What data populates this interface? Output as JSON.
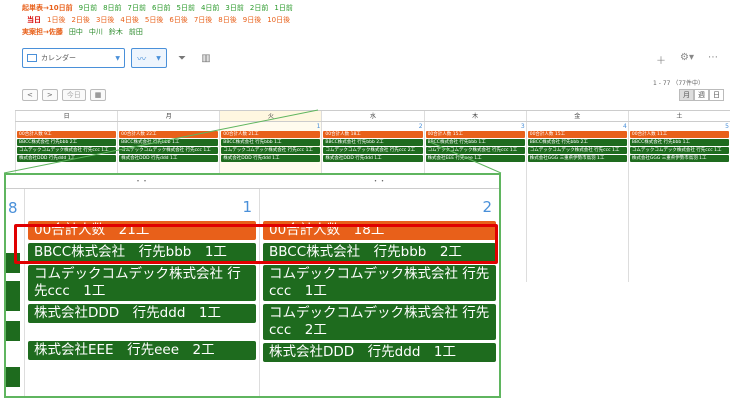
{
  "filters": {
    "row1": {
      "label": "起単表→10日前",
      "links": [
        "9日前",
        "8日前",
        "7日前",
        "6日前",
        "5日前",
        "4日前",
        "3日前",
        "2日前",
        "1日前"
      ]
    },
    "row2": {
      "links": [
        "当日",
        "1日後",
        "2日後",
        "3日後",
        "4日後",
        "5日後",
        "6日後",
        "7日後",
        "8日後",
        "9日後",
        "10日後"
      ]
    },
    "row3": {
      "label": "実案担→佐藤",
      "links": [
        "田中",
        "中川",
        "鈴木",
        "前田"
      ]
    }
  },
  "toolbar": {
    "view_select": "カレンダー",
    "count": "1 - 77 （77件中）"
  },
  "nav": {
    "prev": "<",
    "next": ">",
    "today": "今日"
  },
  "viewtabs": [
    "月",
    "週",
    "日"
  ],
  "weekdays": [
    "日",
    "月",
    "火",
    "水",
    "木",
    "金",
    "土"
  ],
  "mini_dates": [
    "",
    "",
    "",
    "1",
    "2",
    "3",
    "4",
    "5"
  ],
  "mini_columns": [
    [
      "00合計人数 9工",
      "BBCC株式会社 行先bbb 2工",
      "コムデックコムデック株式会社 行先ccc 1工",
      "株式会社DDD 行先ddd 1工"
    ],
    [
      "00合計人数 22工",
      "BBCC株式会社 行先bbb 1工",
      "コムデックコムデック株式会社 行先ccc 1工",
      "株式会社DDD 行先ddd 1工"
    ],
    [
      "00合計人数 21工",
      "BBCC株式会社 行先bbb 1工",
      "コムデックコムデック株式会社 行先ccc 1工",
      "株式会社DDD 行先ddd 1工"
    ],
    [
      "00合計人数 18工",
      "BBCC株式会社 行先bbb 2工",
      "コムデックコムデック株式会社 行先ccc 2工",
      "株式会社DDD 行先ddd 1工"
    ],
    [
      "00合計人数 15工",
      "BBCC株式会社 行先bbb 1工",
      "コムデックコムデック株式会社 行先ccc 1工",
      "株式会社EEE 行先eee 1工"
    ],
    [
      "00合計人数 15工",
      "BBCC株式会社 行先bbb 2工",
      "コムデックコムデック株式会社 行先ccc 1工",
      "株式会社GGG 三重県伊勢市鳥羽 1工"
    ],
    [
      "00合計人数 11工",
      "BBCC株式会社 行先bbb 1工",
      "コムデックコムデック株式会社 行先ccc 1工",
      "株式会社GGG 三重県伊勢市鳥羽 1工"
    ]
  ],
  "zoom": {
    "left_date": "8",
    "col1": {
      "date": "1",
      "events": [
        "00合計人数　21工",
        "BBCC株式会社　行先bbb　1工",
        "コムデックコムデック株式会社 行先ccc　1工",
        "株式会社DDD　行先ddd　1工",
        "株式会社EEE　行先eee　2工"
      ]
    },
    "col2": {
      "date": "2",
      "events": [
        "00合計人数　18工",
        "BBCC株式会社　行先bbb　2工",
        "コムデックコムデック株式会社 行先ccc　1工",
        "コムデックコムデック株式会社 行先ccc　2工",
        "株式会社DDD　行先ddd　1工"
      ]
    }
  },
  "colors": {
    "orange": "#e8601a",
    "green": "#1e6b1e",
    "accent": "#4a90d9",
    "highlight": "#e00000",
    "callout": "#5fb55f"
  }
}
